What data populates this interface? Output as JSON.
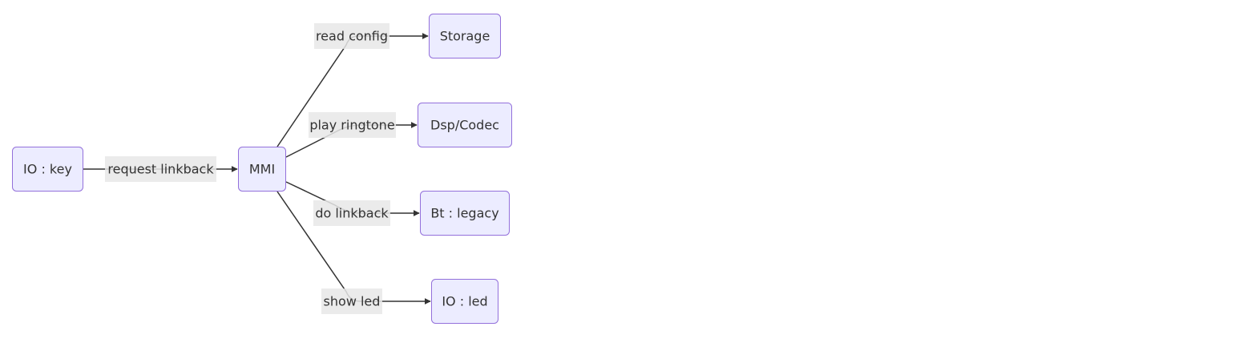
{
  "colors": {
    "node_fill": "#ECECFF",
    "node_stroke": "#9370DB",
    "edge": "#333333",
    "label_bg": "#E8E8E8",
    "text": "#333333"
  },
  "nodes": {
    "io_key": "IO : key",
    "mmi": "MMI",
    "storage": "Storage",
    "dsp_codec": "Dsp/Codec",
    "bt_legacy": "Bt : legacy",
    "io_led": "IO : led"
  },
  "edges": {
    "request_linkback": "request linkback",
    "read_config": "read config",
    "play_ringtone": "play ringtone",
    "do_linkback": "do linkback",
    "show_led": "show led"
  }
}
